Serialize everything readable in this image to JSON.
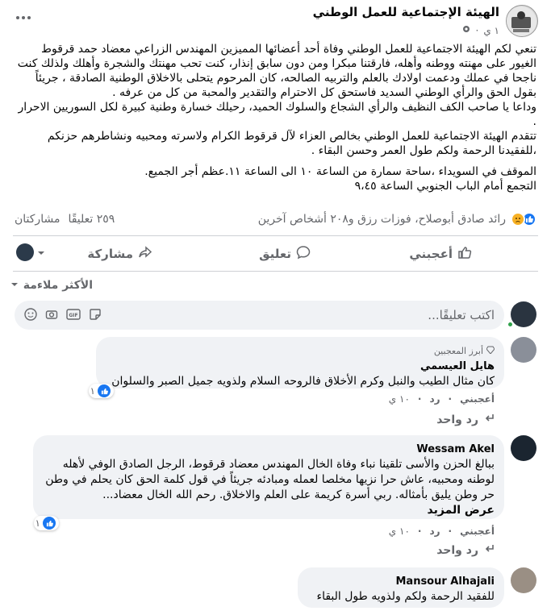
{
  "post": {
    "page_name": "الهيئة الإجتماعية للعمل الوطني",
    "time": "١ ي",
    "paragraphs": [
      "تنعي لكم الهيئة الاجتماعية للعمل الوطني وفاة أحد أعضائها المميزين  المهندس الزراعي معضاد حمد قرقوط الغيور على مهنته ووطنه وأهله، فارقتنا مبكرا ومن دون سابق إنذار، كنت تحب مهنتك والشجرة وأهلك ولذلك كنت ناجحا في عملك ودعمت اولادك بالعلم والتربيه الصالحه، كان المرحوم يتحلى بالاخلاق الوطنية الصادقة ، جريئاً بقول الحق والرأي الوطني السديد فاستحق كل الاحترام والتقدير والمحبة من كل من عرفه .",
      "وداعا يا صاحب الكف النظيف والرأي الشجاع والسلوك الحميد، رحيلك خسارة وطنية كبيرة لكل السوريين الاحرار .",
      "تتقدم الهيئة الاجتماعية للعمل الوطني بخالص العزاء لآل قرقوط الكرام ولاسرته ومحبيه ونشاطرهم حزنكم ،للفقيدنا الرحمة  ولكم طول العمر وحسن البقاء ."
    ],
    "paragraphs2": [
      "الموقف في السويداء ،ساحة سمارة من الساعة  ١٠ الى الساعة ١١.عظم أجر الجميع.",
      "التجمع أمام الباب الجنوبي الساعة ٩،٤٥"
    ],
    "reactions_text": "رائد صادق أبوصلاح، فوزات رزق و٢٠٨ أشخاص آخرين",
    "comments_count": "٢٥٩ تعليقًا",
    "shares_count": "مشاركتان",
    "actions": {
      "like": "أعجبني",
      "comment": "تعليق",
      "share": "مشاركة"
    },
    "sort_label": "الأكثر ملاءمة",
    "comment_placeholder": "اكتب تعليقًا..."
  },
  "comments": [
    {
      "badge": "أبرز المعجبين",
      "author": "هايل العيسمي",
      "text": "كان مثال الطيب والنبل وكرم الأخلاق فالروحه السلام ولذويه جميل الصبر والسلوان",
      "likes": "١",
      "like_label": "أعجبني",
      "reply_label": "رد",
      "time": "١٠ ي",
      "replies": "رد واحد"
    },
    {
      "author": "Wessam Akel",
      "text": "ببالغ الحزن والأسى تلقينا نباء وفاة الخال المهندس معضاد قرقوط، الرجل الصادق الوفي لأهله لوطنه ومحبيه، عاش حرا نزيها مخلصا لعمله ومبادئه جريئاً في قول كلمة الحق كان يحلم في وطن حر وطن يليق بأمثاله. ربي أسرة كريمة على العلم والاخلاق. رحم الله الخال معضاد...",
      "see_more": "عرض المزيد",
      "likes": "١",
      "like_label": "أعجبني",
      "reply_label": "رد",
      "time": "١٠ ي",
      "replies": "رد واحد"
    },
    {
      "author": "Mansour Alhajali",
      "text": "للفقيد الرحمة ولكم ولذويه طول البقاء"
    }
  ],
  "colors": {
    "brand_blue": "#1877f2",
    "muted": "#65676b",
    "bubble": "#f0f2f5"
  }
}
